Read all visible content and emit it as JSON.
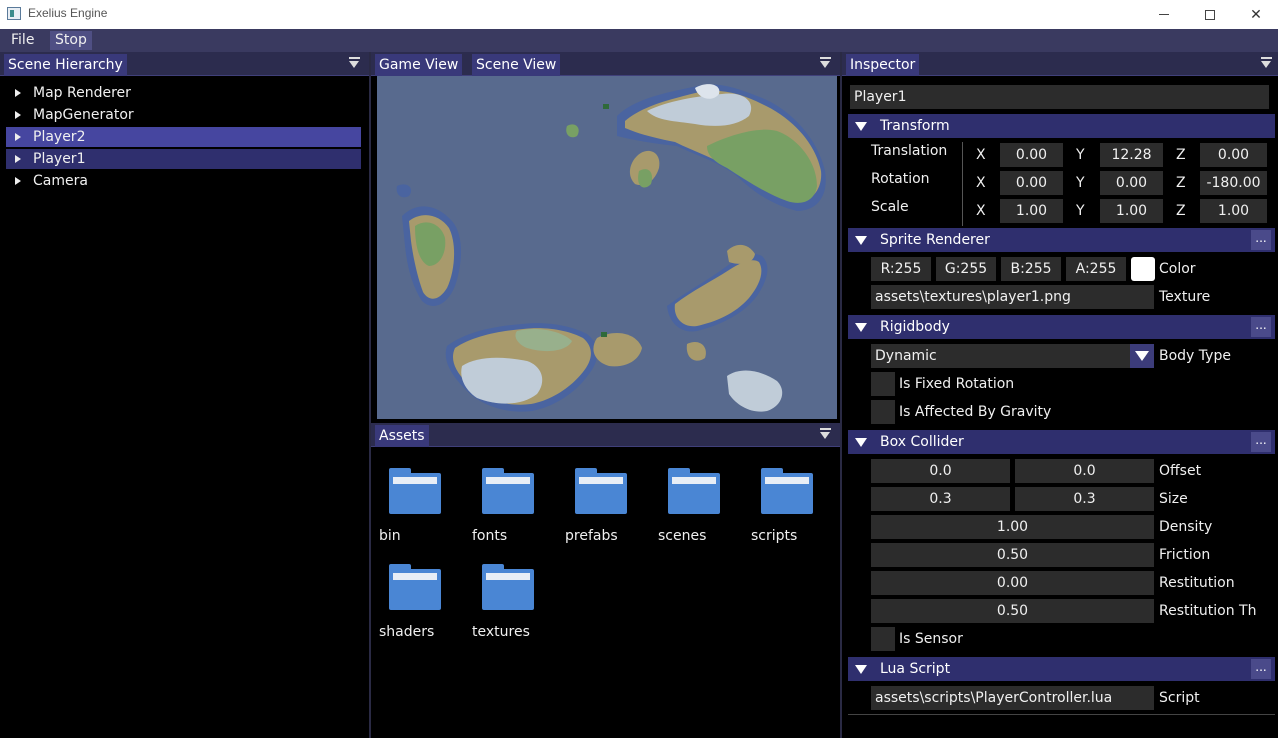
{
  "window": {
    "title": "Exelius Engine"
  },
  "menu": {
    "file": "File",
    "stop": "Stop"
  },
  "hierarchy": {
    "tab": "Scene Hierarchy",
    "items": [
      "Map Renderer",
      "MapGenerator",
      "Player2",
      "Player1",
      "Camera"
    ]
  },
  "views": {
    "game_tab": "Game View",
    "scene_tab": "Scene View"
  },
  "assets": {
    "tab": "Assets",
    "folders": [
      "bin",
      "fonts",
      "prefabs",
      "scenes",
      "scripts",
      "shaders",
      "textures"
    ]
  },
  "inspector": {
    "tab": "Inspector",
    "entity_name": "Player1",
    "transform": {
      "header": "Transform",
      "rows": [
        {
          "label": "Translation",
          "x": "0.00",
          "y": "12.28",
          "z": "0.00"
        },
        {
          "label": "Rotation",
          "x": "0.00",
          "y": "0.00",
          "z": "-180.00"
        },
        {
          "label": "Scale",
          "x": "1.00",
          "y": "1.00",
          "z": "1.00"
        }
      ],
      "axis_x": "X",
      "axis_y": "Y",
      "axis_z": "Z"
    },
    "sprite": {
      "header": "Sprite Renderer",
      "r": "R:255",
      "g": "G:255",
      "b": "B:255",
      "a": "A:255",
      "color_label": "Color",
      "texture_value": "assets\\textures\\player1.png",
      "texture_label": "Texture",
      "swatch_color": "#ffffff"
    },
    "rigidbody": {
      "header": "Rigidbody",
      "body_type_value": "Dynamic",
      "body_type_label": "Body Type",
      "fixed_rotation": "Is Fixed Rotation",
      "affected_gravity": "Is Affected By Gravity"
    },
    "box_collider": {
      "header": "Box Collider",
      "offset_x": "0.0",
      "offset_y": "0.0",
      "offset_label": "Offset",
      "size_x": "0.3",
      "size_y": "0.3",
      "size_label": "Size",
      "density": "1.00",
      "density_label": "Density",
      "friction": "0.50",
      "friction_label": "Friction",
      "restitution": "0.00",
      "restitution_label": "Restitution",
      "restitution_threshold": "0.50",
      "restitution_threshold_label": "Restitution Th",
      "sensor": "Is Sensor"
    },
    "lua_script": {
      "header": "Lua Script",
      "script_value": "assets\\scripts\\PlayerController.lua",
      "script_label": "Script"
    },
    "dots": "..."
  }
}
